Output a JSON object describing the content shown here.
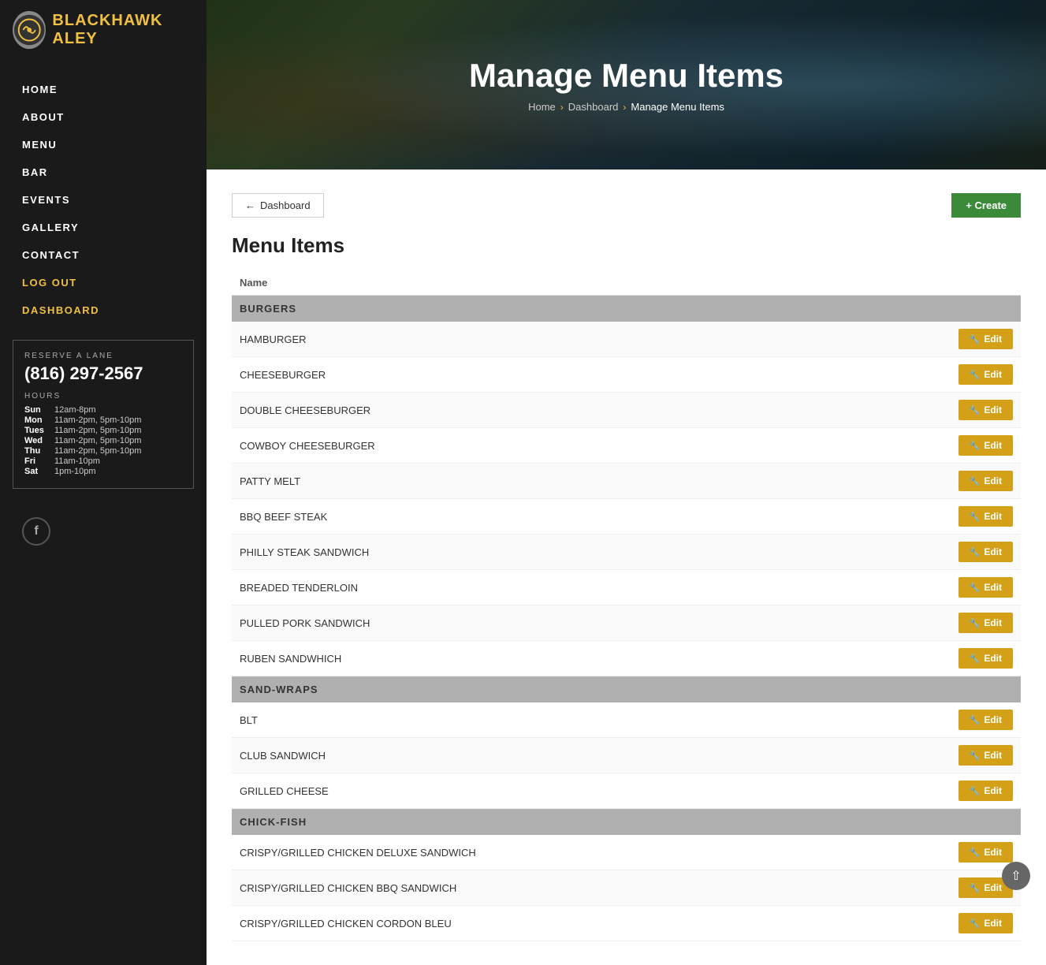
{
  "sidebar": {
    "logo_text_main": "BLACKHAWK A",
    "logo_text_accent": "LEY",
    "nav_items": [
      {
        "label": "HOME",
        "href": "#",
        "active": false
      },
      {
        "label": "ABOUT",
        "href": "#",
        "active": false
      },
      {
        "label": "MENU",
        "href": "#",
        "active": false
      },
      {
        "label": "BAR",
        "href": "#",
        "active": false
      },
      {
        "label": "EVENTS",
        "href": "#",
        "active": false
      },
      {
        "label": "GALLERY",
        "href": "#",
        "active": false
      },
      {
        "label": "CONTACT",
        "href": "#",
        "active": false
      },
      {
        "label": "LOG OUT",
        "href": "#",
        "active": true
      },
      {
        "label": "DASHBOARD",
        "href": "#",
        "active": true
      }
    ],
    "reserve_label": "RESERVE A LANE",
    "phone": "(816) 297-2567",
    "hours_label": "HOURS",
    "hours": [
      {
        "day": "Sun",
        "time": "12am-8pm"
      },
      {
        "day": "Mon",
        "time": "11am-2pm, 5pm-10pm"
      },
      {
        "day": "Tues",
        "time": "11am-2pm, 5pm-10pm"
      },
      {
        "day": "Wed",
        "time": "11am-2pm, 5pm-10pm"
      },
      {
        "day": "Thu",
        "time": "11am-2pm, 5pm-10pm"
      },
      {
        "day": "Fri",
        "time": "11am-10pm"
      },
      {
        "day": "Sat",
        "time": "1pm-10pm"
      }
    ]
  },
  "hero": {
    "title": "Manage Menu Items",
    "breadcrumb_home": "Home",
    "breadcrumb_dashboard": "Dashboard",
    "breadcrumb_current": "Manage Menu Items"
  },
  "toolbar": {
    "back_label": "Dashboard",
    "create_label": "+ Create"
  },
  "content": {
    "section_title": "Menu Items",
    "table_header": "Name",
    "categories": [
      {
        "name": "BURGERS",
        "items": [
          "HAMBURGER",
          "CHEESEBURGER",
          "DOUBLE CHEESEBURGER",
          "COWBOY CHEESEBURGER",
          "PATTY MELT",
          "BBQ BEEF STEAK",
          "PHILLY STEAK SANDWICH",
          "BREADED TENDERLOIN",
          "PULLED PORK SANDWICH",
          "RUBEN SANDWHICH"
        ]
      },
      {
        "name": "SAND-WRAPS",
        "items": [
          "BLT",
          "CLUB SANDWICH",
          "GRILLED CHEESE"
        ]
      },
      {
        "name": "CHICK-FISH",
        "items": [
          "CRISPY/GRILLED CHICKEN DELUXE SANDWICH",
          "CRISPY/GRILLED CHICKEN BBQ SANDWICH",
          "CRISPY/GRILLED CHICKEN CORDON BLEU"
        ]
      }
    ],
    "edit_label": "Edit"
  },
  "colors": {
    "sidebar_bg": "#1a1a1a",
    "accent_gold": "#f0c040",
    "category_bg": "#b0b0b0",
    "edit_btn_bg": "#d4a017",
    "create_btn_bg": "#3a8a3a"
  }
}
